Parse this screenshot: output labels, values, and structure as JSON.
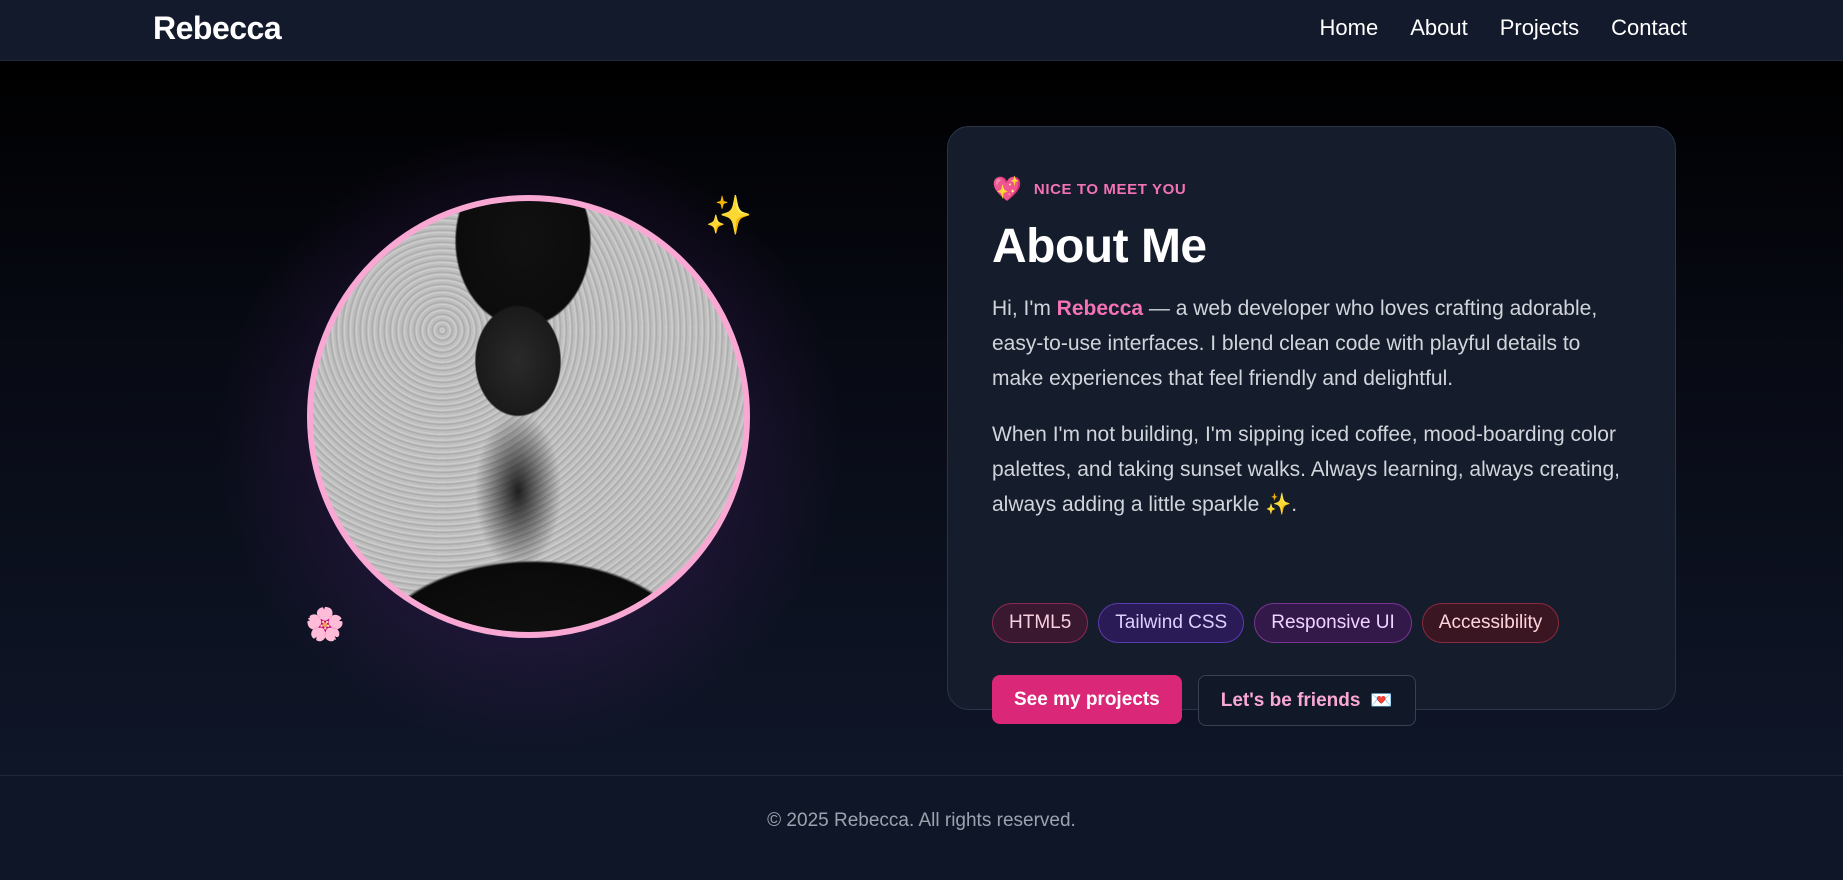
{
  "nav": {
    "brand": "Rebecca",
    "links": [
      "Home",
      "About",
      "Projects",
      "Contact"
    ]
  },
  "hero": {
    "decor": {
      "sparkle_icon": "✨",
      "flower_icon": "🌸"
    }
  },
  "card": {
    "eyebrow_icon": "💖",
    "eyebrow": "NICE TO MEET YOU",
    "title": "About Me",
    "para1": {
      "pre": "Hi, I'm ",
      "name": "Rebecca",
      "post": " — a web developer who loves crafting adorable, easy-to-use interfaces. I blend clean code with playful details to make experiences that feel friendly and delightful."
    },
    "para2": "When I'm not building, I'm sipping iced coffee, mood-boarding color palettes, and taking sunset walks. Always learning, always creating, always adding a little sparkle ✨.",
    "tags": [
      "HTML5",
      "Tailwind CSS",
      "Responsive UI",
      "Accessibility"
    ],
    "primary_button": "See my projects",
    "secondary_button": "Let's be friends",
    "secondary_button_icon": "💌"
  },
  "footer": {
    "text": "© 2025 Rebecca. All rights reserved."
  },
  "colors": {
    "accent": "#f472b6",
    "primary_button": "#db2777",
    "portrait_ring": "#f9a8d4"
  }
}
